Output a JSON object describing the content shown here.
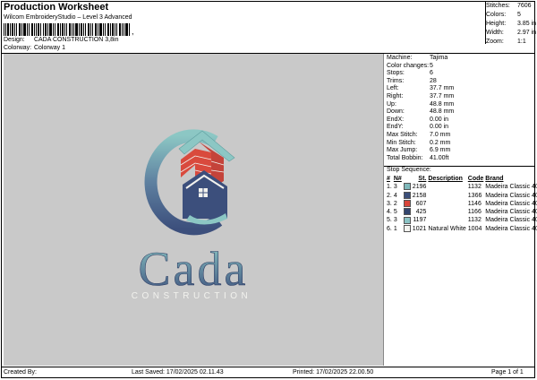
{
  "header": {
    "title": "Production Worksheet",
    "subtitle": "Wilcom EmbroideryStudio – Level 3 Advanced",
    "barcode_suffix": ",",
    "design_label": "Design:",
    "design_value": "CADA CONSTRUCTION 3,8in",
    "colorway_label": "Colorway:",
    "colorway_value": "Colorway 1"
  },
  "summary": [
    {
      "label": "Stitches:",
      "value": "7606"
    },
    {
      "label": "Colors:",
      "value": "5"
    },
    {
      "label": "Height:",
      "value": "3.85 in"
    },
    {
      "label": "Width:",
      "value": "2.97 in"
    },
    {
      "label": "Zoom:",
      "value": "1:1"
    }
  ],
  "machine_info": [
    {
      "label": "Machine:",
      "value": "Tajima"
    },
    {
      "label": "Color changes:",
      "value": "5"
    },
    {
      "label": "Stops:",
      "value": "6"
    },
    {
      "label": "Trims:",
      "value": "28"
    },
    {
      "label": "Left:",
      "value": "37.7 mm"
    },
    {
      "label": "Right:",
      "value": "37.7 mm"
    },
    {
      "label": "Up:",
      "value": "48.8 mm"
    },
    {
      "label": "Down:",
      "value": "48.8 mm"
    },
    {
      "label": "EndX:",
      "value": "0.00 in"
    },
    {
      "label": "EndY:",
      "value": "0.00 in"
    },
    {
      "label": "Max Stitch:",
      "value": "7.0 mm"
    },
    {
      "label": "Min Stitch:",
      "value": "0.2 mm"
    },
    {
      "label": "Max Jump:",
      "value": "6.9 mm"
    },
    {
      "label": "Total Bobbin:",
      "value": "41.00ft"
    }
  ],
  "stop_sequence": {
    "title": "Stop Sequence:",
    "columns": [
      "#",
      "N#",
      "St.",
      "Description",
      "Code",
      "Brand"
    ],
    "rows": [
      {
        "n": "1.",
        "num": "3",
        "color": "#7fb9bb",
        "st": "2196",
        "desc": "",
        "code": "1132",
        "brand": "Madeira Classic 40"
      },
      {
        "n": "2.",
        "num": "4",
        "color": "#3b4f7a",
        "st": "2158",
        "desc": "",
        "code": "1366",
        "brand": "Madeira Classic 40"
      },
      {
        "n": "3.",
        "num": "2",
        "color": "#d8453a",
        "st": "607",
        "desc": "",
        "code": "1146",
        "brand": "Madeira Classic 40"
      },
      {
        "n": "4.",
        "num": "5",
        "color": "#33456e",
        "st": "425",
        "desc": "",
        "code": "1166",
        "brand": "Madeira Classic 40"
      },
      {
        "n": "5.",
        "num": "3",
        "color": "#8bc3c4",
        "st": "1197",
        "desc": "",
        "code": "1132",
        "brand": "Madeira Classic 40"
      },
      {
        "n": "6.",
        "num": "1",
        "color": "#f4f4f0",
        "st": "1021",
        "desc": "Natural White",
        "code": "1004",
        "brand": "Madeira Classic 40"
      }
    ]
  },
  "design": {
    "word": "Cada",
    "tagline": "CONSTRUCTION",
    "colors": {
      "teal": "#8cc7c4",
      "navy": "#3c4f7c",
      "red": "#d94a3d",
      "white": "#f2f2ee",
      "canvas": "#c9c9c9"
    }
  },
  "footer": {
    "created_by_label": "Created By:",
    "last_saved": "Last Saved: 17/02/2025 02.11.43",
    "printed": "Printed: 17/02/2025 22.00.50",
    "page": "Page 1 of 1"
  }
}
